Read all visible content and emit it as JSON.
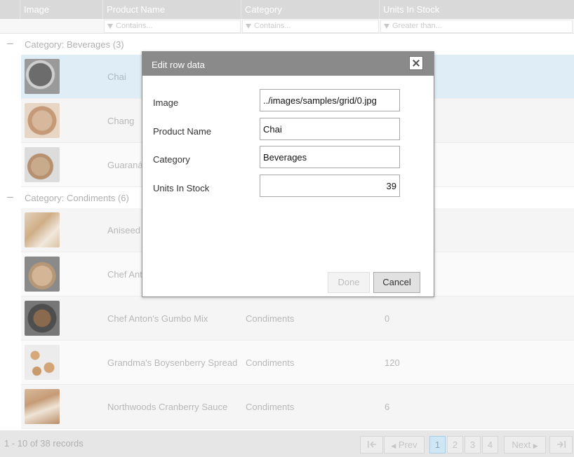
{
  "grid": {
    "columns": [
      "Image",
      "Product Name",
      "Category",
      "Units In Stock"
    ],
    "filters": [
      "Contains...",
      "Contains...",
      "Greater than..."
    ],
    "groups": [
      {
        "label": "Category: Beverages (3)",
        "rows": [
          {
            "name": "Chai",
            "category": "",
            "units": ""
          },
          {
            "name": "Chang",
            "category": "",
            "units": ""
          },
          {
            "name": "Guaraná",
            "category": "",
            "units": ""
          }
        ]
      },
      {
        "label": "Category: Condiments (6)",
        "rows": [
          {
            "name": "Aniseed",
            "category": "",
            "units": ""
          },
          {
            "name": "Chef Ant",
            "category": "",
            "units": ""
          },
          {
            "name": "Chef Anton's Gumbo Mix",
            "category": "Condiments",
            "units": "0"
          },
          {
            "name": "Grandma's Boysenberry Spread",
            "category": "Condiments",
            "units": "120"
          },
          {
            "name": "Northwoods Cranberry Sauce",
            "category": "Condiments",
            "units": "6"
          }
        ]
      }
    ]
  },
  "pager": {
    "count": "1 - 10 of 38 records",
    "first_icon": "first-page-icon",
    "prev": "Prev",
    "pages": [
      "1",
      "2",
      "3",
      "4"
    ],
    "active_page": "1",
    "next": "Next",
    "last_icon": "last-page-icon"
  },
  "dialog": {
    "title": "Edit row data",
    "close_icon": "close-icon",
    "fields": {
      "image": {
        "label": "Image",
        "value": "../images/samples/grid/0.jpg"
      },
      "product_name": {
        "label": "Product Name",
        "value": "Chai"
      },
      "category": {
        "label": "Category",
        "value": "Beverages"
      },
      "units_in_stock": {
        "label": "Units In Stock",
        "value": "39"
      }
    },
    "done_label": "Done",
    "cancel_label": "Cancel"
  },
  "colors": {
    "header_bg": "#d9d9d9",
    "dialog_title_bg": "#8a8a8a",
    "selected_row": "#dfeef6",
    "active_page": "#cfe6f4"
  }
}
